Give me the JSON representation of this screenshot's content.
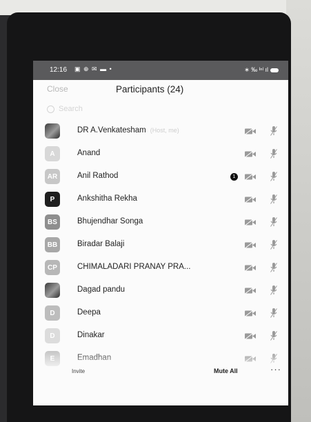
{
  "status_bar": {
    "time": "12:16",
    "left_icons": "▣ ⊕ ✉ ▬ •",
    "right_icons": "∗ ‰ ᴵⁿˡ ıl"
  },
  "header": {
    "close_label": "Close",
    "title": "Participants (24)"
  },
  "search": {
    "placeholder": "Search"
  },
  "participants": [
    {
      "name": "DR A.Venkatesham",
      "suffix": "(Host, me)",
      "avatar_text": "",
      "avatar_color": "#5e5e5e",
      "photo": true,
      "badge": ""
    },
    {
      "name": "Anand",
      "suffix": "",
      "avatar_text": "A",
      "avatar_color": "#d8d8d8",
      "photo": false,
      "badge": ""
    },
    {
      "name": "Anil Rathod",
      "suffix": "",
      "avatar_text": "AR",
      "avatar_color": "#c7c7c7",
      "photo": false,
      "badge": "1"
    },
    {
      "name": "Ankshitha Rekha",
      "suffix": "",
      "avatar_text": "P",
      "avatar_color": "#1f1f1f",
      "photo": false,
      "badge": ""
    },
    {
      "name": "Bhujendhar Songa",
      "suffix": "",
      "avatar_text": "BS",
      "avatar_color": "#8e8e8e",
      "photo": false,
      "badge": ""
    },
    {
      "name": "Biradar Balaji",
      "suffix": "",
      "avatar_text": "BB",
      "avatar_color": "#a8a8a8",
      "photo": false,
      "badge": ""
    },
    {
      "name": "CHIMALADARI PRANAY PRA...",
      "suffix": "",
      "avatar_text": "CP",
      "avatar_color": "#b7b7b7",
      "photo": false,
      "badge": ""
    },
    {
      "name": "Dagad pandu",
      "suffix": "",
      "avatar_text": "",
      "avatar_color": "#5b5b5b",
      "photo": true,
      "badge": ""
    },
    {
      "name": "Deepa",
      "suffix": "",
      "avatar_text": "D",
      "avatar_color": "#bdbdbd",
      "photo": false,
      "badge": ""
    },
    {
      "name": "Dinakar",
      "suffix": "",
      "avatar_text": "D",
      "avatar_color": "#dcdcdc",
      "photo": false,
      "badge": ""
    },
    {
      "name": "Emadhan",
      "suffix": "",
      "avatar_text": "E",
      "avatar_color": "#c4c4c4",
      "photo": false,
      "badge": ""
    }
  ],
  "footer": {
    "invite_label": "Invite",
    "mute_all_label": "Mute All",
    "more_label": "···"
  },
  "colors": {
    "icon_gray": "#9a9a9a",
    "screen_bg": "#fbfbfb",
    "status_bar_bg": "#5a5a5c"
  }
}
